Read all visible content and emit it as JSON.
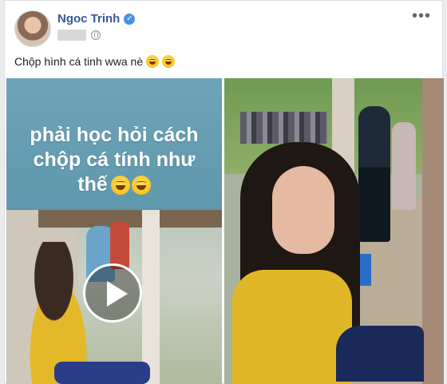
{
  "post": {
    "author_name": "Ngoc Trinh",
    "verified_icon": "verified-check-icon",
    "privacy_icon": "globe-icon",
    "more_label": "•••",
    "text": "Chộp hình cá tinh wwa nè",
    "text_emojis": [
      "laughing-emoji",
      "laughing-emoji"
    ]
  },
  "media": {
    "left": {
      "caption_lines": [
        "phải học hỏi cách",
        "chộp cá tính như",
        "thế"
      ],
      "caption_emojis": [
        "rofl-emoji",
        "laughing-emoji"
      ],
      "play_icon": "play-icon"
    }
  },
  "colors": {
    "author": "#385898",
    "caption_bg": "#6ea4b8",
    "verified": "#4a90e2"
  }
}
